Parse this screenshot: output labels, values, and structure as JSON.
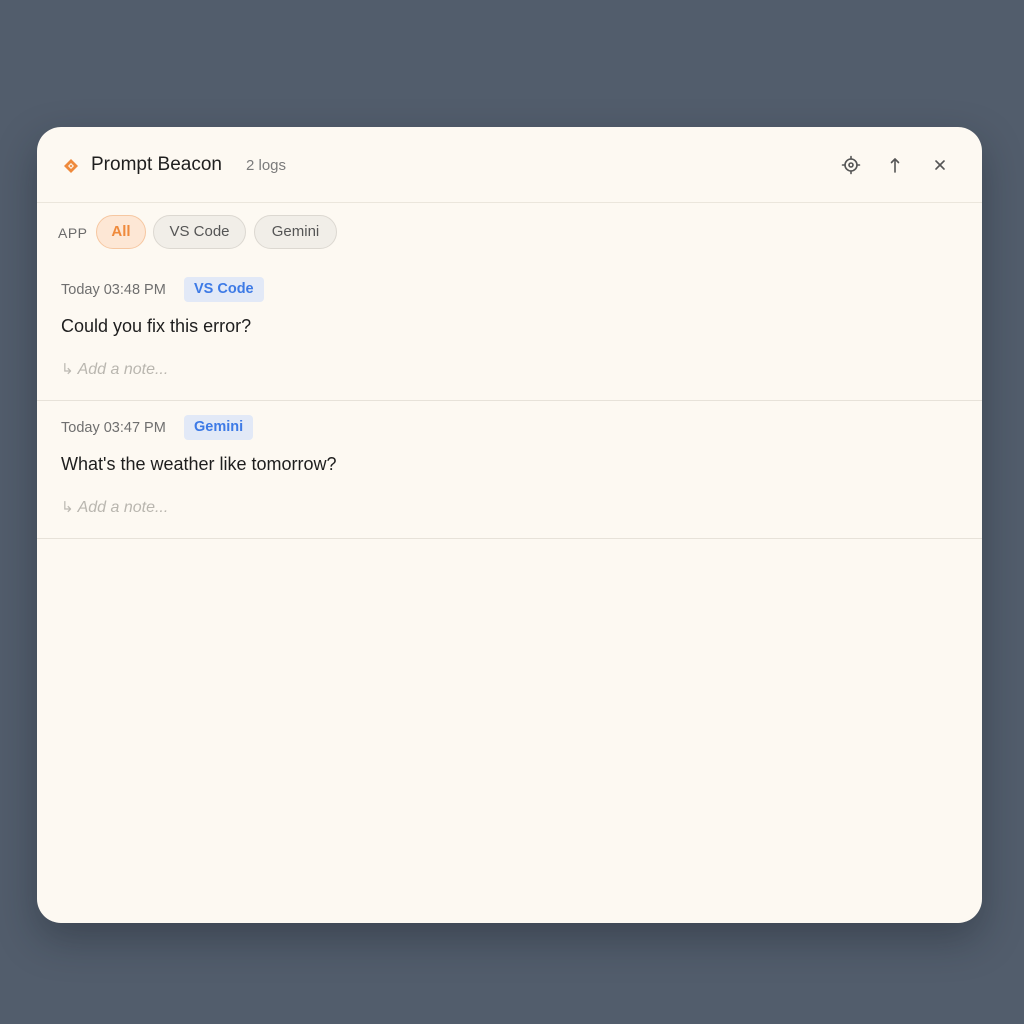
{
  "header": {
    "title": "Prompt Beacon",
    "log_count": "2 logs",
    "icons": {
      "logo": "diamond-logo-icon",
      "settings": "gear-icon",
      "export": "arrow-up-icon",
      "close": "close-icon"
    }
  },
  "filters": {
    "label": "APP",
    "chips": [
      {
        "label": "All",
        "active": true
      },
      {
        "label": "VS Code",
        "active": false
      },
      {
        "label": "Gemini",
        "active": false
      }
    ]
  },
  "entries": [
    {
      "timestamp": "Today 03:48 PM",
      "app": "VS Code",
      "prompt": "Could you fix this error?",
      "note_icon": "↳",
      "note_placeholder": "Add a note..."
    },
    {
      "timestamp": "Today 03:47 PM",
      "app": "Gemini",
      "prompt": "What's the weather like tomorrow?",
      "note_icon": "↳",
      "note_placeholder": "Add a note..."
    }
  ],
  "colors": {
    "accent": "#ef8a3c",
    "badge_text": "#3d7ae6",
    "badge_bg": "#e2e9f7",
    "window_bg": "#fdf9f2",
    "backdrop": "#525d6c"
  }
}
